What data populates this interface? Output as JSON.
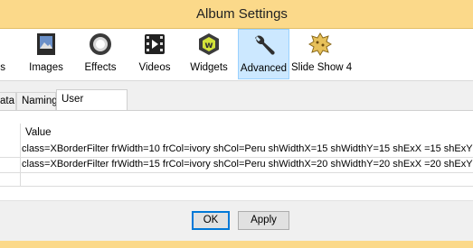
{
  "window": {
    "title": "Album Settings"
  },
  "toolbar": {
    "items": [
      {
        "label": "s",
        "icon": "partial-icon"
      },
      {
        "label": "Images",
        "icon": "images-icon"
      },
      {
        "label": "Effects",
        "icon": "effects-icon"
      },
      {
        "label": "Videos",
        "icon": "videos-icon"
      },
      {
        "label": "Widgets",
        "icon": "widgets-icon"
      },
      {
        "label": "Advanced",
        "icon": "wrench-icon",
        "active": true
      },
      {
        "label": "Slide Show 4",
        "icon": "slideshow-icon"
      }
    ]
  },
  "tabs": [
    {
      "label": "ata"
    },
    {
      "label": "Naming"
    },
    {
      "label": "User Variables",
      "active": true
    }
  ],
  "table": {
    "header": "Value",
    "rows": [
      {
        "value": "class=XBorderFilter frWidth=10 frCol=ivory shCol=Peru   shWidthX=15 shWidthY=15 shExX =15 shExY"
      },
      {
        "value": "class=XBorderFilter frWidth=15 frCol=ivory shCol=Peru   shWidthX=20 shWidthY=20 shExX =20 shExY"
      }
    ]
  },
  "buttons": {
    "ok": "OK",
    "apply": "Apply"
  },
  "colors": {
    "titlebar": "#fbd98a",
    "active_tool": "#cce8ff"
  }
}
